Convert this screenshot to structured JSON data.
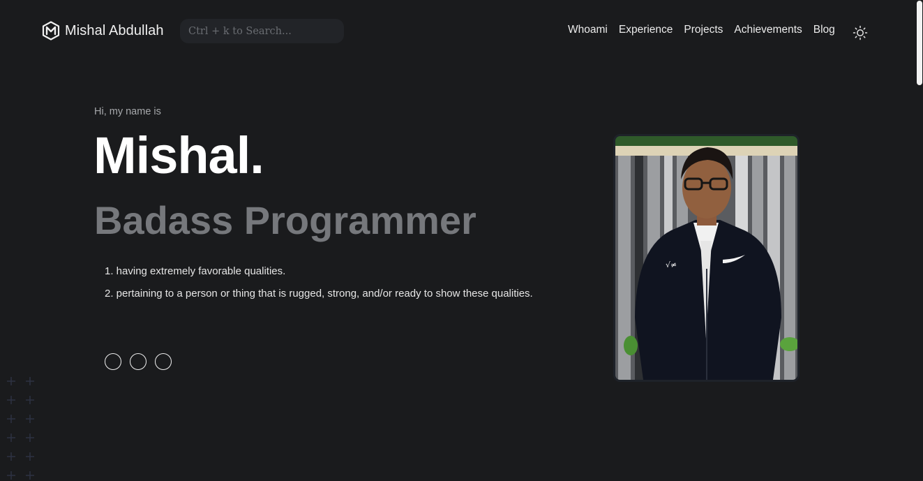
{
  "header": {
    "brand": {
      "name": "Mishal Abdullah",
      "logo_icon": "m-hexagon-logo"
    },
    "search": {
      "placeholder": "Ctrl + k to Search..."
    },
    "nav": [
      {
        "label": "Whoami"
      },
      {
        "label": "Experience"
      },
      {
        "label": "Projects"
      },
      {
        "label": "Achievements"
      },
      {
        "label": "Blog"
      }
    ],
    "theme_toggle_icon": "sun-icon"
  },
  "hero": {
    "greeting": "Hi, my name is",
    "name": "Mishal.",
    "role": "Badass Programmer",
    "definitions": [
      "1. having extremely favorable qualities.",
      "2. pertaining to a person or thing that is rugged, strong, and/or ready to show these qualities."
    ],
    "social_icons": [
      "social-link-icon",
      "social-link-icon",
      "social-link-icon"
    ]
  },
  "profile_photo": {
    "subject": "profile-photo"
  },
  "colors": {
    "background": "#1a1b1d",
    "search_bg": "#222428",
    "role_text": "#76787c",
    "plus_pattern": "#2d3243"
  }
}
